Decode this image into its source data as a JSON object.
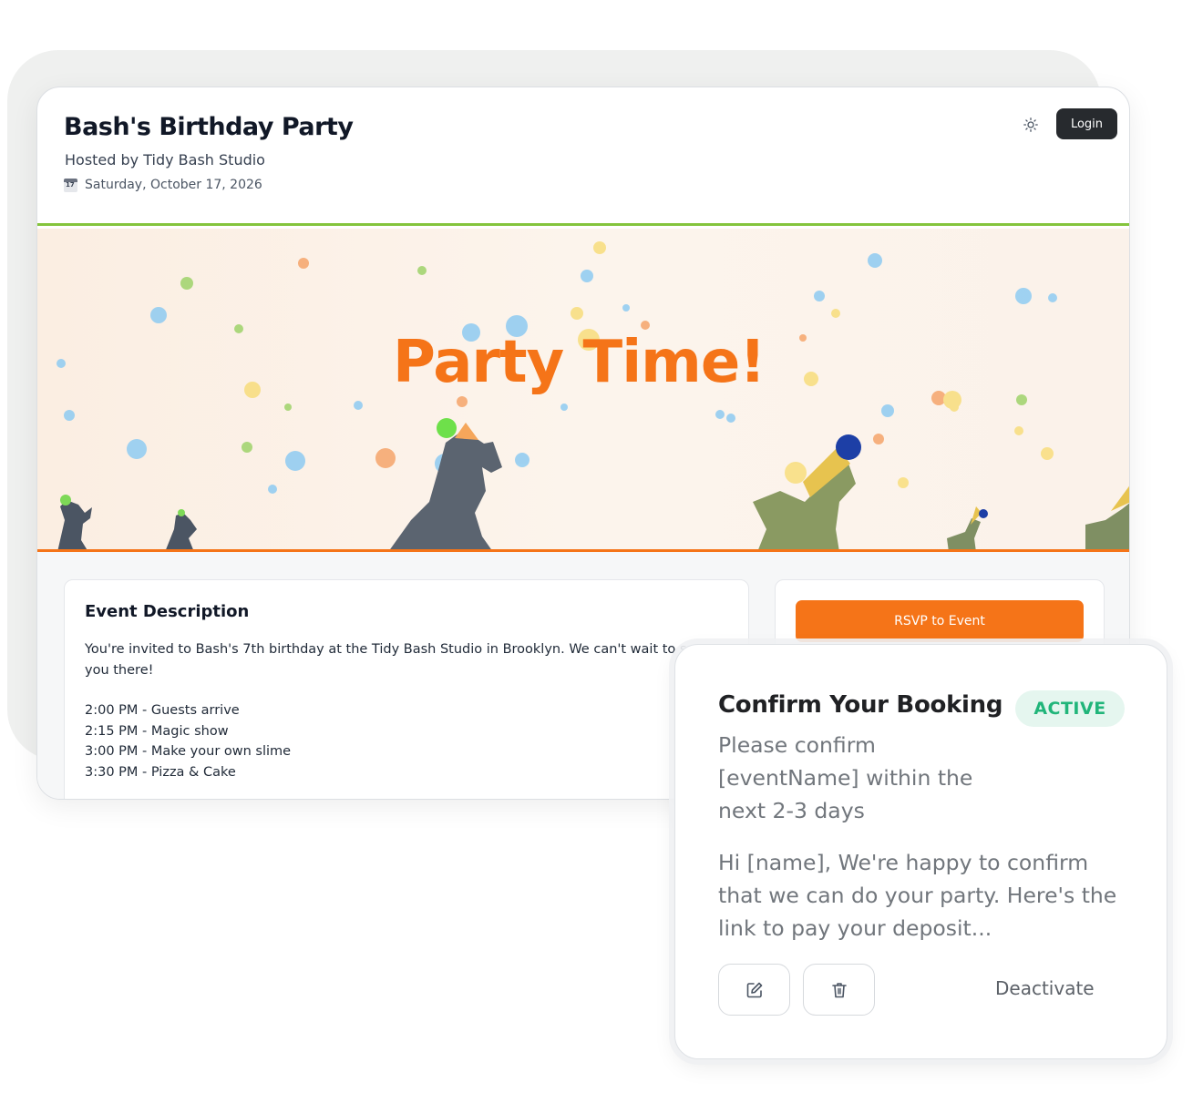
{
  "event": {
    "title": "Bash's Birthday Party",
    "host": "Hosted by Tidy Bash Studio",
    "date": "Saturday, October 17, 2026",
    "login_label": "Login",
    "banner_text": "Party Time!",
    "description_title": "Event Description",
    "description_text": "You're invited to Bash's 7th birthday at the Tidy Bash Studio in Brooklyn. We can't wait to see you there!",
    "schedule": [
      "2:00 PM - Guests arrive",
      "2:15 PM - Magic show",
      "3:00 PM - Make your own slime",
      "3:30 PM - Pizza & Cake"
    ],
    "rsvp_label": "RSVP to Event"
  },
  "template": {
    "title": "Confirm Your Booking",
    "status": "ACTIVE",
    "subject": "Please confirm [eventName] within the next 2-3 days",
    "body": "Hi [name], We're happy to confirm that we can do your party. Here's the link to pay your deposit...",
    "deactivate_label": "Deactivate"
  },
  "colors": {
    "brand_orange": "#f57418",
    "header_green": "#84c43c",
    "active_green": "#21b57a",
    "dark_button": "#272a2e"
  },
  "icons": [
    "calendar-icon",
    "sun-icon",
    "edit-icon",
    "trash-icon"
  ]
}
